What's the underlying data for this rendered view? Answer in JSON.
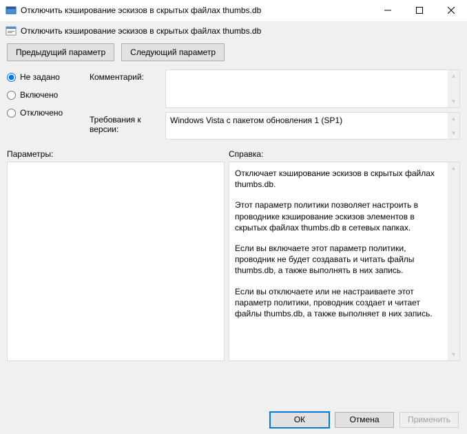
{
  "window": {
    "title": "Отключить кэширование эскизов в скрытых файлах thumbs.db"
  },
  "header": {
    "title": "Отключить кэширование эскизов в скрытых файлах thumbs.db"
  },
  "nav": {
    "prev": "Предыдущий параметр",
    "next": "Следующий параметр"
  },
  "radios": {
    "not_configured": "Не задано",
    "enabled": "Включено",
    "disabled": "Отключено",
    "selected": "not_configured"
  },
  "fields": {
    "comment_label": "Комментарий:",
    "comment_value": "",
    "requirement_label": "Требования к версии:",
    "requirement_value": "Windows Vista с пакетом обновления 1 (SP1)"
  },
  "lower": {
    "params_label": "Параметры:",
    "help_label": "Справка:",
    "help_paragraphs": [
      "Отключает кэширование эскизов в скрытых файлах thumbs.db.",
      "Этот параметр политики позволяет настроить в проводнике кэширование эскизов элементов в скрытых файлах thumbs.db в сетевых папках.",
      "Если вы включаете этот параметр политики, проводник не будет создавать и читать файлы thumbs.db, а также выполнять в них запись.",
      "Если вы отключаете или не настраиваете этот параметр политики, проводник создает и читает файлы thumbs.db, а также выполняет в них запись."
    ]
  },
  "buttons": {
    "ok": "ОК",
    "cancel": "Отмена",
    "apply": "Применить"
  }
}
